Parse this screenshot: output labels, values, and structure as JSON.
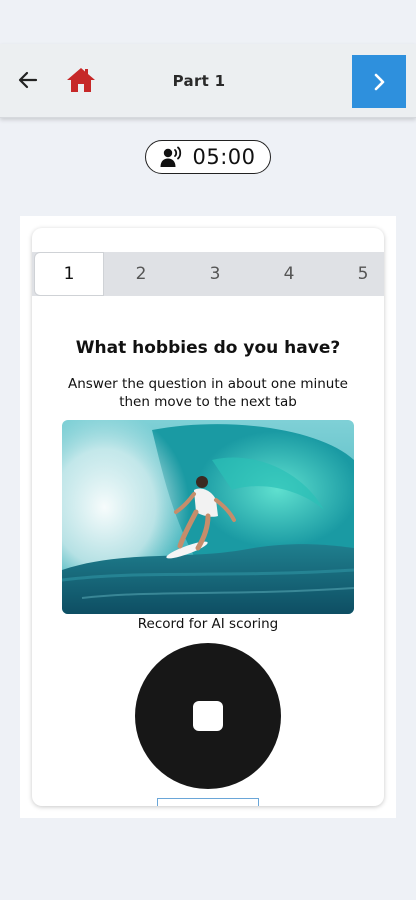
{
  "header": {
    "title": "Part 1",
    "back_icon": "arrow-left-icon",
    "home_icon": "home-icon",
    "next_icon": "chevron-right-icon",
    "home_color": "#c62828",
    "next_bg": "#2e90dd"
  },
  "timer": {
    "icon": "speaking-person-icon",
    "value": "05:00"
  },
  "tabs": [
    {
      "label": "1",
      "active": true
    },
    {
      "label": "2",
      "active": false
    },
    {
      "label": "3",
      "active": false
    },
    {
      "label": "4",
      "active": false
    },
    {
      "label": "5",
      "active": false
    }
  ],
  "task": {
    "question": "What hobbies do you have?",
    "instruction": "Answer the question in about one minute then move to the next tab",
    "image_subject": "surfer riding a wave",
    "record_label": "Record for AI scoring",
    "record_icon": "stop-icon"
  }
}
